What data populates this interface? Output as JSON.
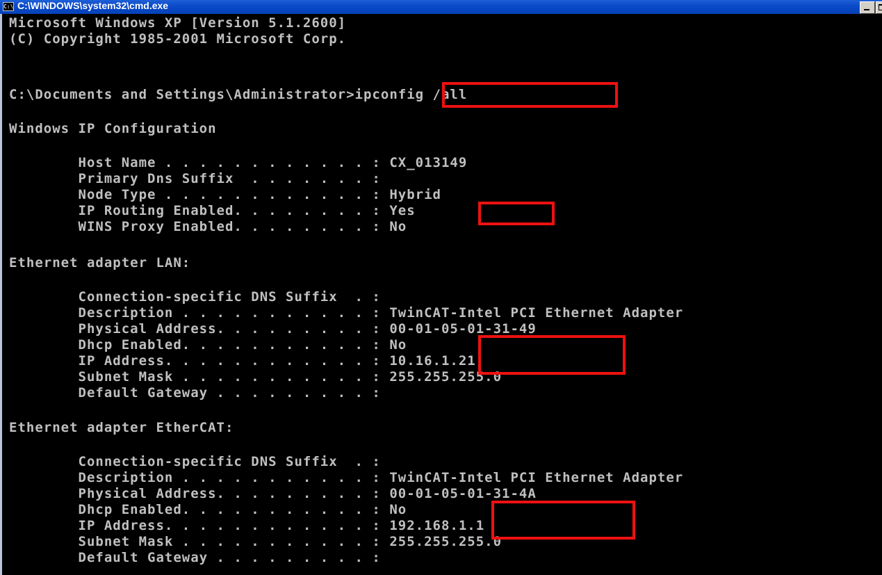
{
  "window": {
    "title": "C:\\WINDOWS\\system32\\cmd.exe",
    "icon": "console-icon",
    "titlebar_color": "#0a49c9",
    "background": "#000000",
    "text_color": "#c0c0c0",
    "highlight_color": "#ee1111"
  },
  "console": {
    "lines": [
      "Microsoft Windows XP [Version 5.1.2600]",
      "(C) Copyright 1985-2001 Microsoft Corp.",
      "C:\\Documents and Settings\\Administrator>ipconfig /all",
      "Windows IP Configuration",
      "        Host Name . . . . . . . . . . . . : CX_013149",
      "        Primary Dns Suffix  . . . . . . . :",
      "        Node Type . . . . . . . . . . . . : Hybrid",
      "        IP Routing Enabled. . . . . . . . : Yes",
      "        WINS Proxy Enabled. . . . . . . . : No",
      "Ethernet adapter LAN:",
      "        Connection-specific DNS Suffix  . :",
      "        Description . . . . . . . . . . . : TwinCAT-Intel PCI Ethernet Adapter",
      "        Physical Address. . . . . . . . . : 00-01-05-01-31-49",
      "        Dhcp Enabled. . . . . . . . . . . : No",
      "        IP Address. . . . . . . . . . . . : 10.16.1.21",
      "        Subnet Mask . . . . . . . . . . . : 255.255.255.0",
      "        Default Gateway . . . . . . . . . :",
      "Ethernet adapter EtherCAT:",
      "        Connection-specific DNS Suffix  . :",
      "        Description . . . . . . . . . . . : TwinCAT-Intel PCI Ethernet Adapter",
      "        Physical Address. . . . . . . . . : 00-01-05-01-31-4A",
      "        Dhcp Enabled. . . . . . . . . . . : No",
      "        IP Address. . . . . . . . . . . . : 192.168.1.1",
      "        Subnet Mask . . . . . . . . . . . : 255.255.255.0",
      "        Default Gateway . . . . . . . . . :"
    ]
  },
  "highlights": [
    "command",
    "ip-routing-value",
    "lan-dhcp-ip",
    "ethercat-dhcp-ip"
  ]
}
